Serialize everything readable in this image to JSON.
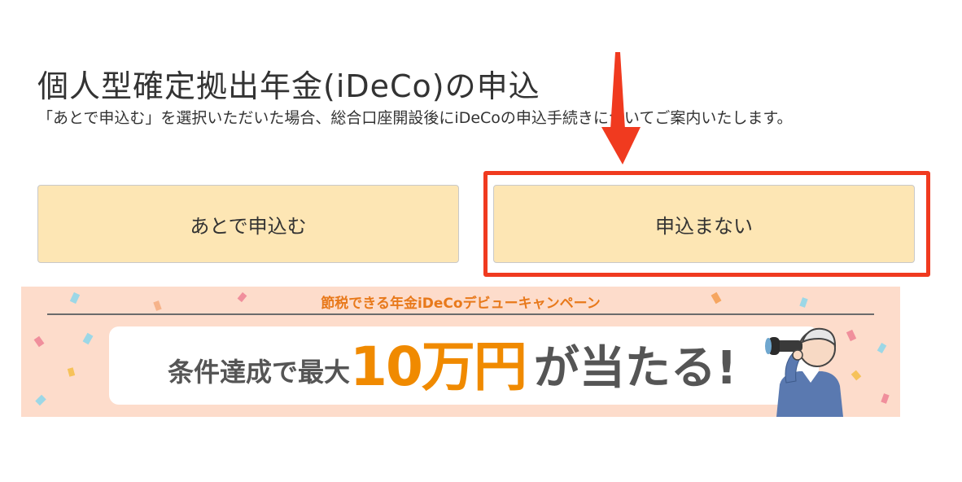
{
  "page": {
    "title": "個人型確定拠出年金(iDeCo)の申込",
    "description": "「あとで申込む」を選択いただいた場合、総合口座開設後にiDeCoの申込手続きについてご案内いたします。"
  },
  "buttons": {
    "later_label": "あとで申込む",
    "decline_label": "申込まない"
  },
  "banner": {
    "heading": "節税できる年金iDeCoデビューキャンペーン",
    "main_prefix": "条件達成で最大",
    "main_amount": "10万円",
    "main_suffix": "が当たる!"
  },
  "colors": {
    "button_bg": "#fde6b4",
    "highlight_red": "#f03a1f",
    "banner_bg": "#fddccb",
    "banner_accent": "#f08a00"
  },
  "icons": {
    "arrow": "red-down-arrow",
    "illustration": "person-with-binoculars"
  }
}
